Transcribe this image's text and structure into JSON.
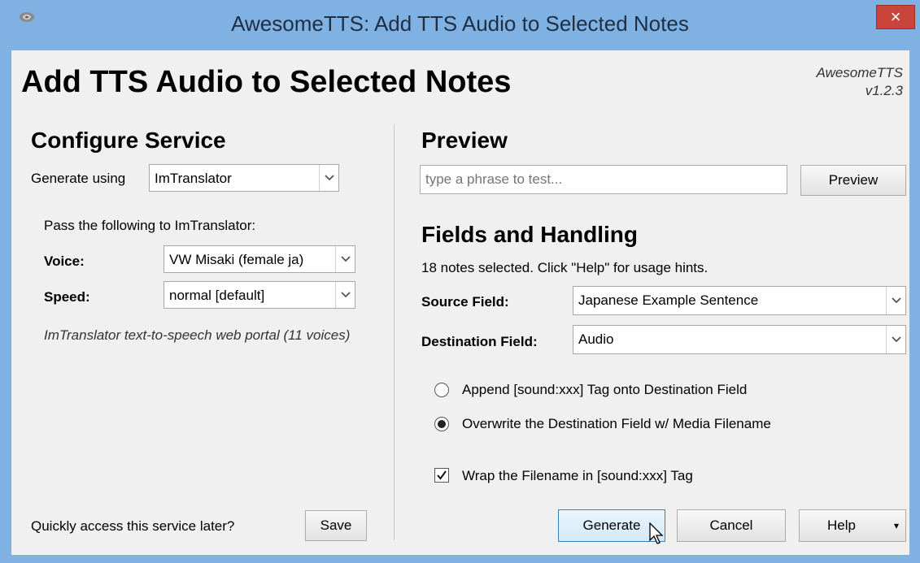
{
  "window": {
    "title": "AwesomeTTS: Add TTS Audio to Selected Notes",
    "close_glyph": "×"
  },
  "header": {
    "heading": "Add TTS Audio to Selected Notes",
    "version_line1": "AwesomeTTS",
    "version_line2": "v1.2.3"
  },
  "configure": {
    "title": "Configure Service",
    "generate_using_label": "Generate using",
    "service_value": "ImTranslator",
    "pass_label": "Pass the following to ImTranslator:",
    "voice_label": "Voice:",
    "voice_value": "VW Misaki (female ja)",
    "speed_label": "Speed:",
    "speed_value": "normal [default]",
    "description": "ImTranslator text-to-speech web portal (11 voices)",
    "quick_access_label": "Quickly access this service later?",
    "save_label": "Save"
  },
  "preview": {
    "title": "Preview",
    "placeholder": "type a phrase to test...",
    "button_label": "Preview"
  },
  "fields": {
    "title": "Fields and Handling",
    "notes_selected": "18 notes selected. Click \"Help\" for usage hints.",
    "source_label": "Source Field:",
    "source_value": "Japanese Example Sentence",
    "destination_label": "Destination Field:",
    "destination_value": "Audio",
    "append_option": "Append [sound:xxx] Tag onto Destination Field",
    "overwrite_option": "Overwrite the Destination Field w/ Media Filename",
    "wrap_option": "Wrap the Filename in [sound:xxx] Tag",
    "selected_option": "overwrite",
    "wrap_checked": true
  },
  "actions": {
    "generate_label": "Generate",
    "cancel_label": "Cancel",
    "help_label": "Help"
  },
  "icons": {
    "app": "speaker-app-icon",
    "close": "close-icon",
    "dropdown": "chevron-down-icon",
    "cursor": "mouse-pointer-icon"
  }
}
